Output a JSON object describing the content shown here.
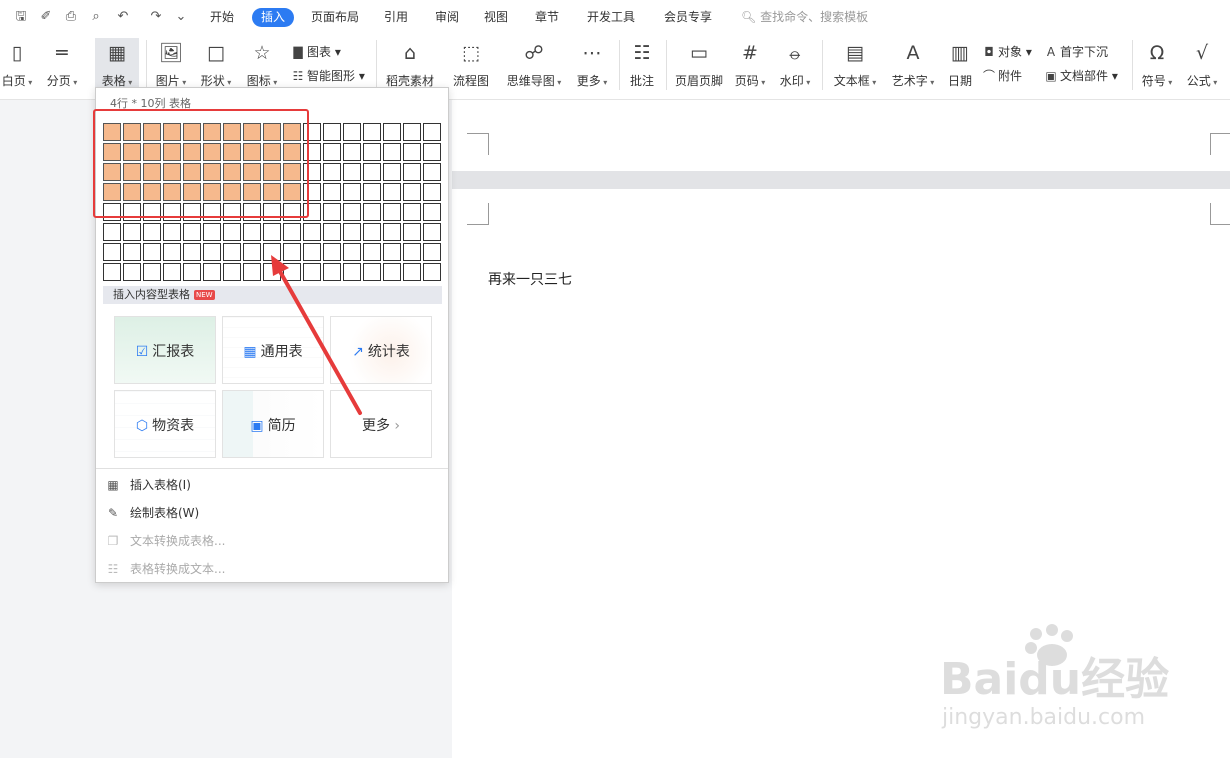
{
  "quick_access": {
    "icons": [
      "save-icon",
      "format-painter-icon",
      "print-icon",
      "print-preview-icon",
      "undo-icon",
      "redo-icon",
      "more-icon"
    ]
  },
  "tabs": [
    "开始",
    "插入",
    "页面布局",
    "引用",
    "审阅",
    "视图",
    "章节",
    "开发工具",
    "会员专享"
  ],
  "active_tab": "插入",
  "search": {
    "placeholder": "查找命令、搜索模板"
  },
  "ribbon": {
    "blank_page": "白页",
    "page_break": "分页",
    "table": "表格",
    "picture": "图片",
    "shape": "形状",
    "icon": "图标",
    "chart": "图表",
    "smart_art": "智能图形",
    "daoke": "稻壳素材",
    "flowchart": "流程图",
    "mindmap": "思维导图",
    "more": "更多",
    "comment": "批注",
    "header_footer": "页眉页脚",
    "page_number": "页码",
    "watermark": "水印",
    "textbox": "文本框",
    "wordart": "艺术字",
    "date": "日期",
    "object": "对象",
    "attachment": "附件",
    "drop_cap": "首字下沉",
    "doc_parts": "文档部件",
    "symbol": "符号",
    "formula": "公式"
  },
  "dropdown": {
    "header": "4行 * 10列 表格",
    "grid": {
      "rows": 8,
      "cols": 17,
      "selected_rows": 4,
      "selected_cols": 10
    },
    "section_title": "插入内容型表格",
    "badge": "NEW",
    "cards": [
      "汇报表",
      "通用表",
      "统计表",
      "物资表",
      "简历",
      "更多"
    ],
    "menu": [
      {
        "label": "插入表格(I)",
        "enabled": true
      },
      {
        "label": "绘制表格(W)",
        "enabled": true
      },
      {
        "label": "文本转换成表格...",
        "enabled": false
      },
      {
        "label": "表格转换成文本...",
        "enabled": false
      }
    ]
  },
  "document": {
    "text": "再来一只三七"
  },
  "watermark": {
    "brand": "Baidu经验",
    "url": "jingyan.baidu.com"
  },
  "colors": {
    "accent": "#2c7bf2",
    "selected_cell": "#f6b98d",
    "highlight_box": "#e63b3b",
    "arrow": "#e63b3b"
  }
}
